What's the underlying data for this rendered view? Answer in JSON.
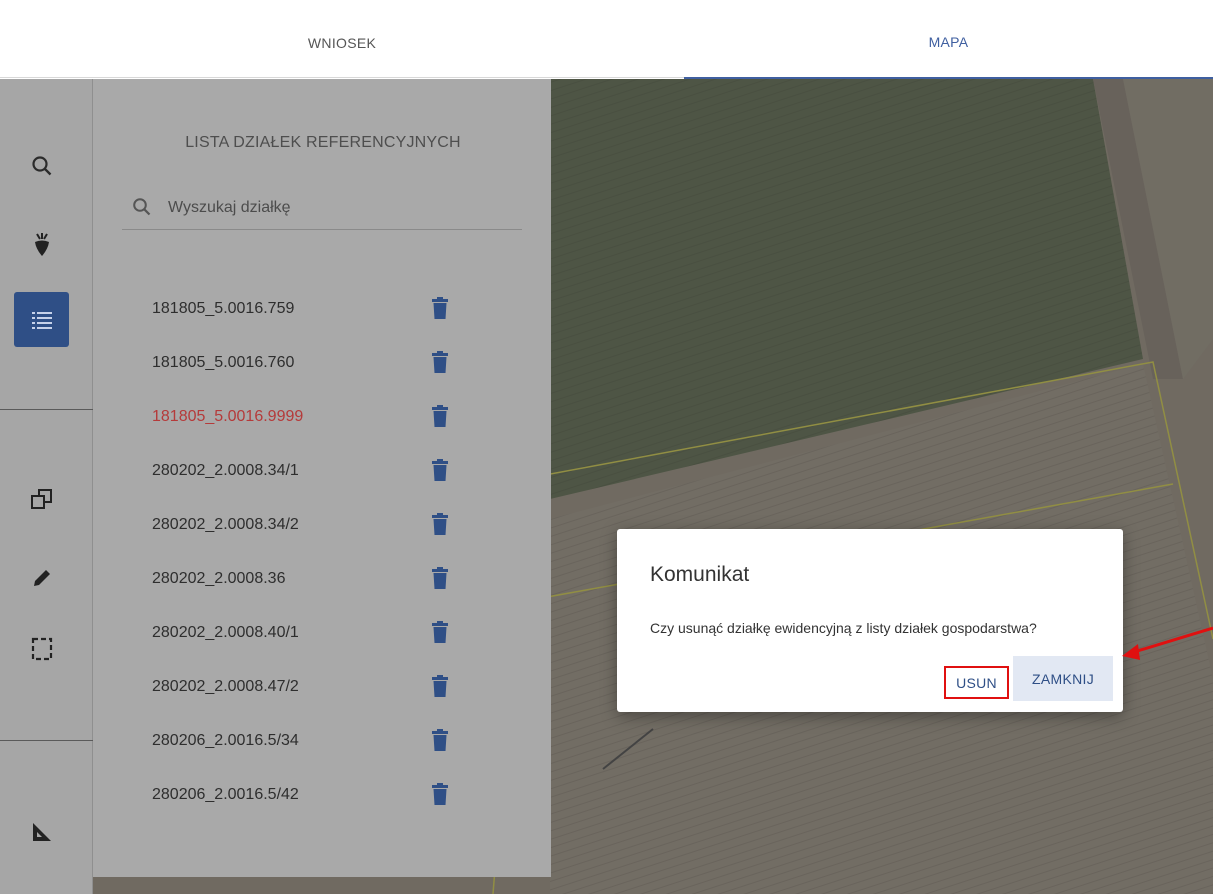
{
  "tabs": [
    {
      "label": "WNIOSEK"
    },
    {
      "label": "MAPA"
    }
  ],
  "toolbar": {
    "tools": [
      {
        "icon": "search-icon"
      },
      {
        "icon": "beet-icon"
      },
      {
        "icon": "list-icon",
        "active": true
      },
      {
        "icon": "copy-icon"
      },
      {
        "icon": "pencil-icon"
      },
      {
        "icon": "select-rectangle-icon"
      },
      {
        "icon": "ruler-triangle-icon"
      }
    ]
  },
  "panel": {
    "title": "LISTA DZIAŁEK REFERENCYJNYCH",
    "search_placeholder": "Wyszukaj działkę",
    "items": [
      {
        "label": "181805_5.0016.759"
      },
      {
        "label": "181805_5.0016.760"
      },
      {
        "label": "181805_5.0016.9999",
        "highlight": true
      },
      {
        "label": "280202_2.0008.34/1"
      },
      {
        "label": "280202_2.0008.34/2"
      },
      {
        "label": "280202_2.0008.36"
      },
      {
        "label": "280202_2.0008.40/1"
      },
      {
        "label": "280202_2.0008.47/2"
      },
      {
        "label": "280206_2.0016.5/34"
      },
      {
        "label": "280206_2.0016.5/42"
      }
    ]
  },
  "dialog": {
    "title": "Komunikat",
    "message": "Czy usunąć działkę ewidencyjną z listy działek gospodarstwa?",
    "confirm_label": "USUN",
    "close_label": "ZAMKNIJ"
  },
  "colors": {
    "accent": "#2f4f86",
    "error_text": "#b53a3a",
    "annotation": "#e01010"
  }
}
